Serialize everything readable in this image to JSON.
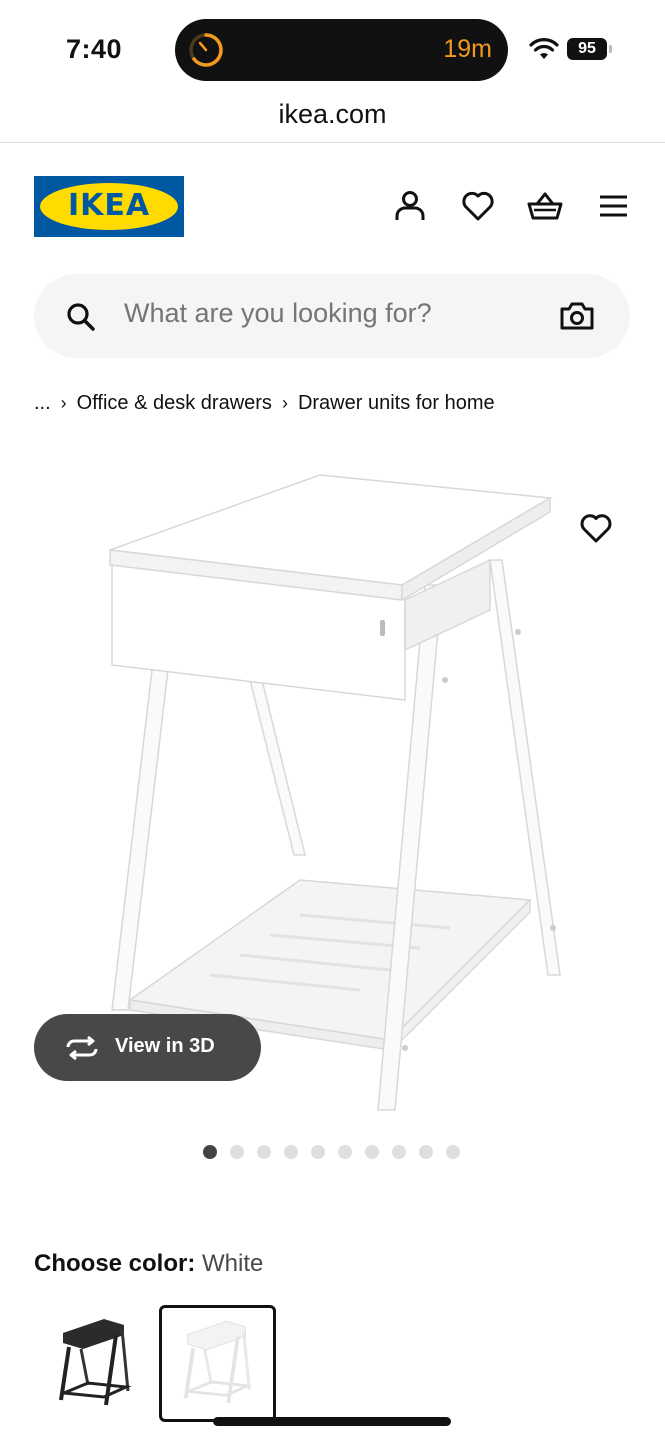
{
  "status_bar": {
    "time": "7:40",
    "activity_timer": "19m",
    "battery": "95"
  },
  "browser": {
    "url": "ikea.com"
  },
  "header": {
    "logo_text": "IKEA"
  },
  "search": {
    "placeholder": "What are you looking for?"
  },
  "breadcrumb": {
    "ellipsis": "...",
    "items": [
      "Office & desk drawers",
      "Drawer units for home"
    ]
  },
  "product": {
    "view_3d_label": "View in 3D",
    "image_count": 10,
    "active_image_index": 0
  },
  "color": {
    "label": "Choose color:",
    "value": "White",
    "options": [
      "black",
      "white"
    ],
    "selected_index": 1
  },
  "colors": {
    "brand_blue": "#0058a3",
    "brand_yellow": "#ffdb00",
    "timer_orange": "#f29a1d",
    "button_gray": "#484848"
  }
}
